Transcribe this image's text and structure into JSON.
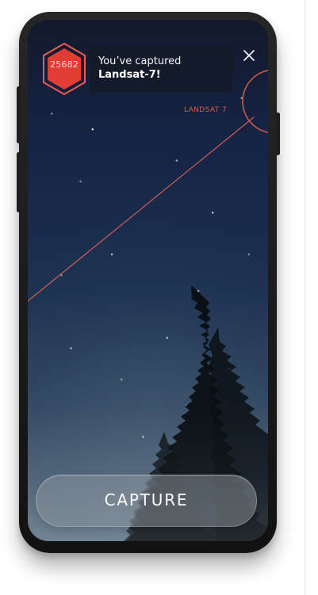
{
  "badge": {
    "value": "25682"
  },
  "notification": {
    "line1": "You’ve captured",
    "line2": "Landsat-7!"
  },
  "satellite": {
    "label": "LANDSAT 7"
  },
  "actions": {
    "capture_label": "CAPTURE"
  },
  "icons": {
    "badge": "hexagon-badge",
    "close": "close-icon",
    "target": "target-ring"
  },
  "colors": {
    "accent_red": "#d94e44",
    "badge_red": "#e23d35",
    "badge_outline": "#ef5b53",
    "line_red": "#cf5f54"
  }
}
